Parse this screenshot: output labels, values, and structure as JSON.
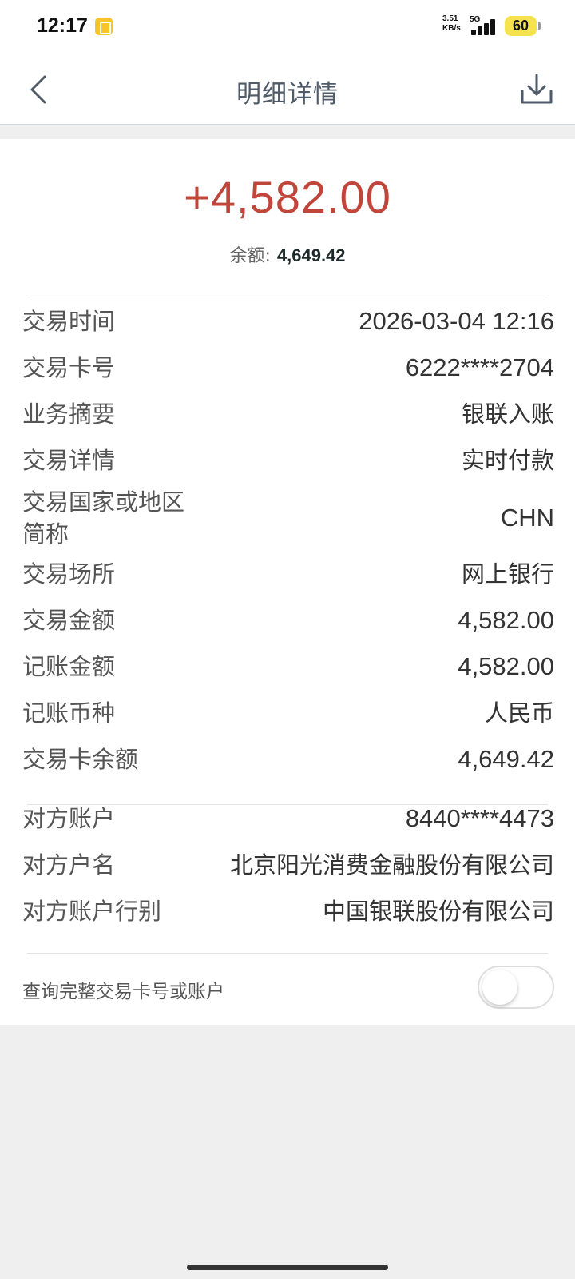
{
  "status_bar": {
    "time": "12:17",
    "net_speed_value": "3.51",
    "net_speed_unit": "KB/s",
    "network_type": "5G",
    "battery": "60"
  },
  "nav": {
    "title": "明细详情",
    "back_icon": "chevron-left-icon",
    "download_icon": "download-icon"
  },
  "summary": {
    "amount": "+4,582.00",
    "balance_label": "余额:",
    "balance_value": "4,649.42"
  },
  "details": [
    {
      "label": "交易时间",
      "value": "2026-03-04 12:16"
    },
    {
      "label": "交易卡号",
      "value": "6222****2704"
    },
    {
      "label": "业务摘要",
      "value": "银联入账"
    },
    {
      "label": "交易详情",
      "value": "实时付款"
    },
    {
      "label_line1": "交易国家或地区",
      "label_line2": "简称",
      "value": "CHN"
    },
    {
      "label": "交易场所",
      "value": "网上银行"
    },
    {
      "label": "交易金额",
      "value": "4,582.00"
    },
    {
      "label": "记账金额",
      "value": "4,582.00"
    },
    {
      "label": "记账币种",
      "value": "人民币"
    },
    {
      "label": "交易卡余额",
      "value": "4,649.42"
    }
  ],
  "counterparty": [
    {
      "label": "对方账户",
      "value": "8440****4473"
    },
    {
      "label": "对方户名",
      "value": "北京阳光消费金融股份有限公司"
    },
    {
      "label": "对方账户行别",
      "value": "中国银联股份有限公司"
    }
  ],
  "toggle": {
    "label": "查询完整交易卡号或账户",
    "state": "off"
  },
  "colors": {
    "amount": "#c0453a",
    "title": "#4f5b68",
    "page_bg": "#efefef"
  }
}
